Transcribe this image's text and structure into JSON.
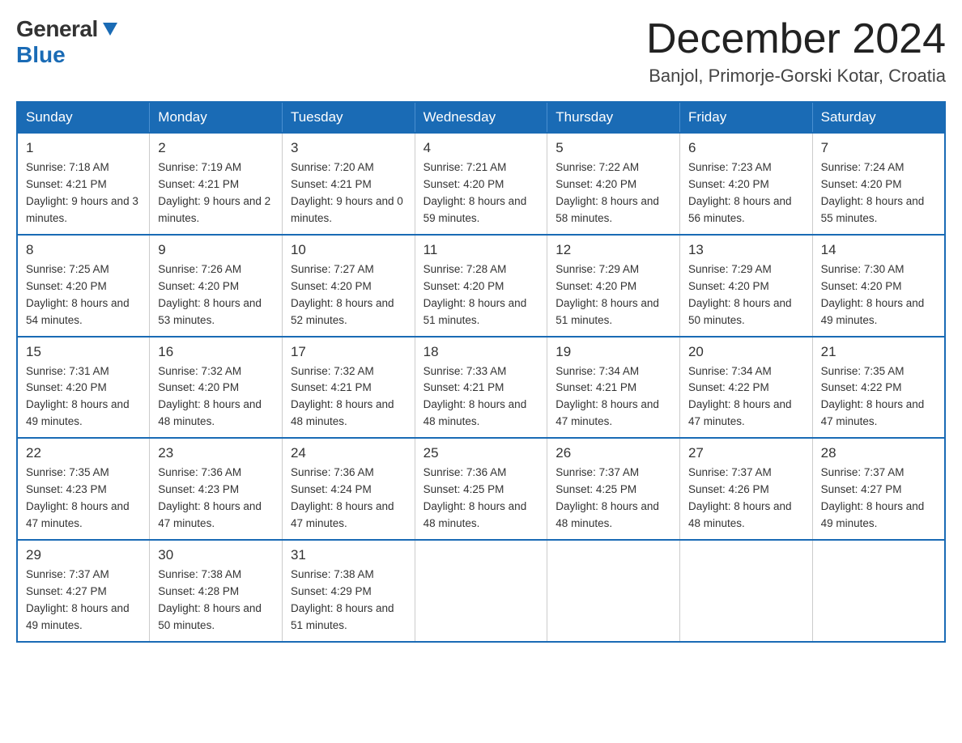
{
  "logo": {
    "general": "General",
    "blue": "Blue"
  },
  "title": "December 2024",
  "location": "Banjol, Primorje-Gorski Kotar, Croatia",
  "days_of_week": [
    "Sunday",
    "Monday",
    "Tuesday",
    "Wednesday",
    "Thursday",
    "Friday",
    "Saturday"
  ],
  "weeks": [
    [
      {
        "num": "1",
        "sunrise": "7:18 AM",
        "sunset": "4:21 PM",
        "daylight": "9 hours and 3 minutes."
      },
      {
        "num": "2",
        "sunrise": "7:19 AM",
        "sunset": "4:21 PM",
        "daylight": "9 hours and 2 minutes."
      },
      {
        "num": "3",
        "sunrise": "7:20 AM",
        "sunset": "4:21 PM",
        "daylight": "9 hours and 0 minutes."
      },
      {
        "num": "4",
        "sunrise": "7:21 AM",
        "sunset": "4:20 PM",
        "daylight": "8 hours and 59 minutes."
      },
      {
        "num": "5",
        "sunrise": "7:22 AM",
        "sunset": "4:20 PM",
        "daylight": "8 hours and 58 minutes."
      },
      {
        "num": "6",
        "sunrise": "7:23 AM",
        "sunset": "4:20 PM",
        "daylight": "8 hours and 56 minutes."
      },
      {
        "num": "7",
        "sunrise": "7:24 AM",
        "sunset": "4:20 PM",
        "daylight": "8 hours and 55 minutes."
      }
    ],
    [
      {
        "num": "8",
        "sunrise": "7:25 AM",
        "sunset": "4:20 PM",
        "daylight": "8 hours and 54 minutes."
      },
      {
        "num": "9",
        "sunrise": "7:26 AM",
        "sunset": "4:20 PM",
        "daylight": "8 hours and 53 minutes."
      },
      {
        "num": "10",
        "sunrise": "7:27 AM",
        "sunset": "4:20 PM",
        "daylight": "8 hours and 52 minutes."
      },
      {
        "num": "11",
        "sunrise": "7:28 AM",
        "sunset": "4:20 PM",
        "daylight": "8 hours and 51 minutes."
      },
      {
        "num": "12",
        "sunrise": "7:29 AM",
        "sunset": "4:20 PM",
        "daylight": "8 hours and 51 minutes."
      },
      {
        "num": "13",
        "sunrise": "7:29 AM",
        "sunset": "4:20 PM",
        "daylight": "8 hours and 50 minutes."
      },
      {
        "num": "14",
        "sunrise": "7:30 AM",
        "sunset": "4:20 PM",
        "daylight": "8 hours and 49 minutes."
      }
    ],
    [
      {
        "num": "15",
        "sunrise": "7:31 AM",
        "sunset": "4:20 PM",
        "daylight": "8 hours and 49 minutes."
      },
      {
        "num": "16",
        "sunrise": "7:32 AM",
        "sunset": "4:20 PM",
        "daylight": "8 hours and 48 minutes."
      },
      {
        "num": "17",
        "sunrise": "7:32 AM",
        "sunset": "4:21 PM",
        "daylight": "8 hours and 48 minutes."
      },
      {
        "num": "18",
        "sunrise": "7:33 AM",
        "sunset": "4:21 PM",
        "daylight": "8 hours and 48 minutes."
      },
      {
        "num": "19",
        "sunrise": "7:34 AM",
        "sunset": "4:21 PM",
        "daylight": "8 hours and 47 minutes."
      },
      {
        "num": "20",
        "sunrise": "7:34 AM",
        "sunset": "4:22 PM",
        "daylight": "8 hours and 47 minutes."
      },
      {
        "num": "21",
        "sunrise": "7:35 AM",
        "sunset": "4:22 PM",
        "daylight": "8 hours and 47 minutes."
      }
    ],
    [
      {
        "num": "22",
        "sunrise": "7:35 AM",
        "sunset": "4:23 PM",
        "daylight": "8 hours and 47 minutes."
      },
      {
        "num": "23",
        "sunrise": "7:36 AM",
        "sunset": "4:23 PM",
        "daylight": "8 hours and 47 minutes."
      },
      {
        "num": "24",
        "sunrise": "7:36 AM",
        "sunset": "4:24 PM",
        "daylight": "8 hours and 47 minutes."
      },
      {
        "num": "25",
        "sunrise": "7:36 AM",
        "sunset": "4:25 PM",
        "daylight": "8 hours and 48 minutes."
      },
      {
        "num": "26",
        "sunrise": "7:37 AM",
        "sunset": "4:25 PM",
        "daylight": "8 hours and 48 minutes."
      },
      {
        "num": "27",
        "sunrise": "7:37 AM",
        "sunset": "4:26 PM",
        "daylight": "8 hours and 48 minutes."
      },
      {
        "num": "28",
        "sunrise": "7:37 AM",
        "sunset": "4:27 PM",
        "daylight": "8 hours and 49 minutes."
      }
    ],
    [
      {
        "num": "29",
        "sunrise": "7:37 AM",
        "sunset": "4:27 PM",
        "daylight": "8 hours and 49 minutes."
      },
      {
        "num": "30",
        "sunrise": "7:38 AM",
        "sunset": "4:28 PM",
        "daylight": "8 hours and 50 minutes."
      },
      {
        "num": "31",
        "sunrise": "7:38 AM",
        "sunset": "4:29 PM",
        "daylight": "8 hours and 51 minutes."
      },
      null,
      null,
      null,
      null
    ]
  ]
}
